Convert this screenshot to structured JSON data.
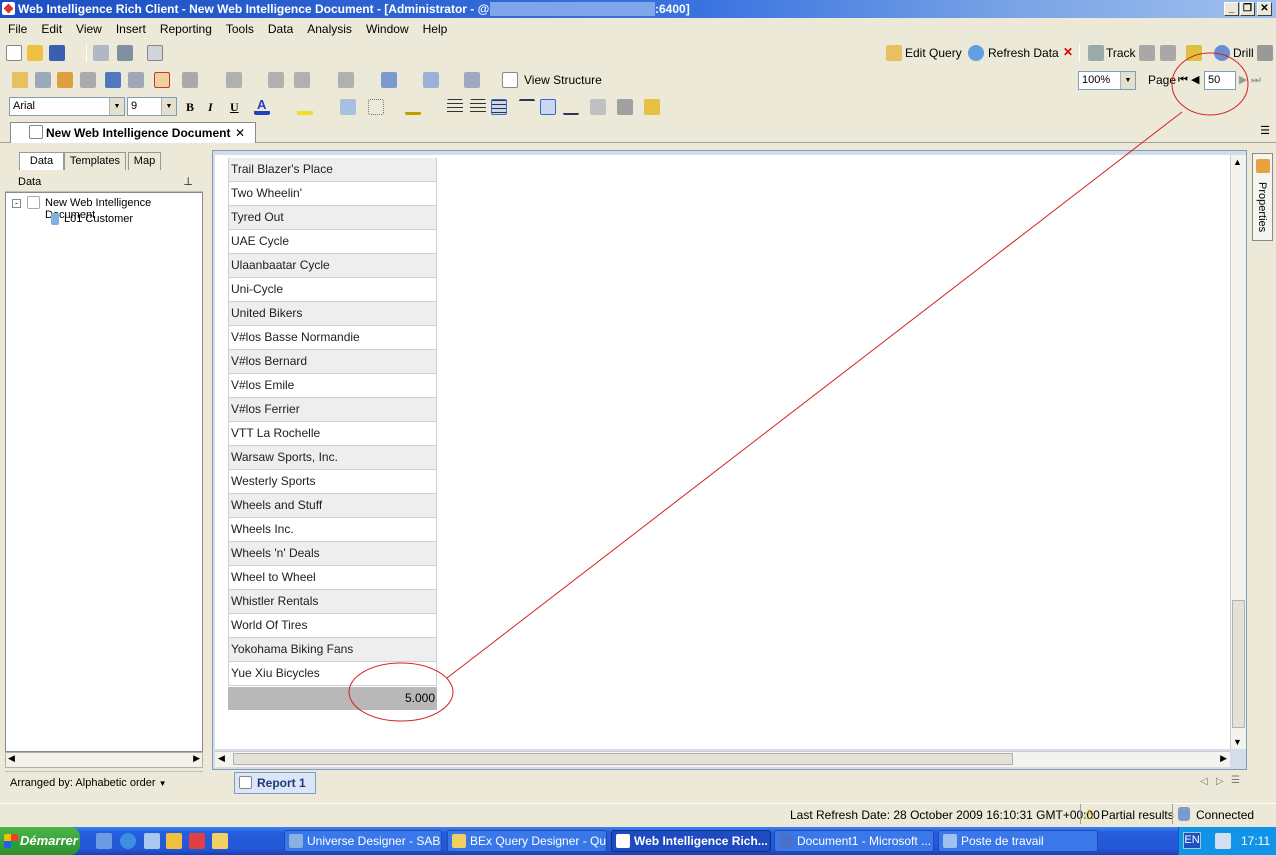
{
  "window": {
    "title_left": "Web Intelligence Rich Client - New Web Intelligence Document - [Administrator - @",
    "title_right": ":6400]"
  },
  "menu": [
    "File",
    "Edit",
    "View",
    "Insert",
    "Reporting",
    "Tools",
    "Data",
    "Analysis",
    "Window",
    "Help"
  ],
  "toolbar": {
    "edit_query": "Edit Query",
    "refresh_data": "Refresh Data",
    "track": "Track",
    "drill": "Drill",
    "view_structure": "View Structure",
    "zoom": "100%",
    "page_label": "Page",
    "page_value": "50",
    "font_name": "Arial",
    "font_size": "9",
    "bold": "B",
    "italic": "I",
    "underline": "U"
  },
  "doc_tab": "New Web Intelligence Document",
  "left_panel": {
    "tabs": [
      "Data",
      "Templates",
      "Map"
    ],
    "header": "Data",
    "tree_root": "New Web Intelligence Document",
    "tree_child": "L01 Customer",
    "arranged_by": "Arranged by: Alphabetic order"
  },
  "report": {
    "customers": [
      "Trail Blazer's Place",
      "Two Wheelin'",
      "Tyred Out",
      "UAE Cycle",
      "Ulaanbaatar Cycle",
      "Uni-Cycle",
      "United Bikers",
      "V#los Basse Normandie",
      "V#los Bernard",
      "V#los Emile",
      "V#los Ferrier",
      "VTT La Rochelle",
      "Warsaw Sports, Inc.",
      "Westerly Sports",
      "Wheels and Stuff",
      "Wheels Inc.",
      "Wheels 'n' Deals",
      "Wheel to Wheel",
      "Whistler Rentals",
      "World Of Tires",
      "Yokohama Biking Fans",
      "Yue Xiu Bicycles"
    ],
    "total": "5.000",
    "tab_label": "Report 1"
  },
  "properties_label": "Properties",
  "status": {
    "last_refresh": "Last Refresh Date: 28 October 2009 16:10:31 GMT+00:00",
    "partial": "Partial results",
    "connected": "Connected"
  },
  "taskbar": {
    "start": "Démarrer",
    "tasks": [
      "Universe Designer - SAB...",
      "BEx Query Designer - Qu...",
      "Web Intelligence Rich...",
      "Document1 - Microsoft ...",
      "Poste de travail"
    ],
    "lang": "EN",
    "clock": "17:11"
  }
}
